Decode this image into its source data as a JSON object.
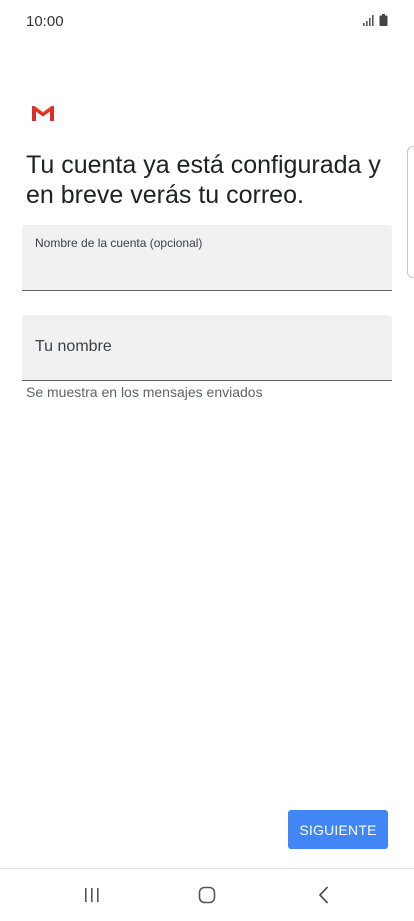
{
  "status_bar": {
    "time": "10:00",
    "icons": [
      "signal-icon",
      "battery-icon"
    ]
  },
  "logo": {
    "icon": "gmail-logo-icon",
    "colors": [
      "#d93025",
      "#ea4335"
    ]
  },
  "headline": "Tu cuenta ya está configurada y en breve verás tu correo.",
  "account_field": {
    "label": "Nombre de la cuenta (opcional)",
    "value": ""
  },
  "name_field": {
    "placeholder": "Tu nombre",
    "value": "",
    "helper": "Se muestra en los mensajes enviados"
  },
  "next_button": {
    "label": "SIGUIENTE",
    "color": "#4285f4"
  },
  "nav_bar": {
    "buttons": [
      "recents-icon",
      "home-icon",
      "back-icon"
    ]
  }
}
